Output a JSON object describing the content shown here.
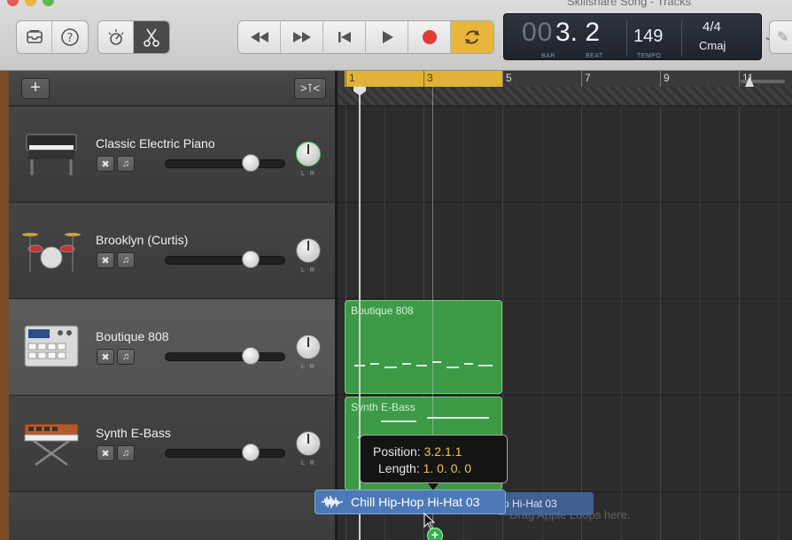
{
  "window": {
    "title": "Skillshare Song - Tracks"
  },
  "toolbar": {
    "left_icons": [
      "library-icon",
      "help-icon"
    ],
    "edit_icons": [
      "smart-controls-icon",
      "scissors-icon"
    ],
    "transport_icons": [
      "rewind-icon",
      "fast-forward-icon",
      "go-to-beginning-icon",
      "play-icon",
      "record-icon",
      "cycle-icon"
    ],
    "colors": {
      "record": "#e23c36",
      "cycle_active": "#e9b63b"
    }
  },
  "lcd": {
    "bar_digits": "00",
    "position": "3. 2",
    "bar_label": "BAR",
    "beat_label": "BEAT",
    "tempo": "149",
    "tempo_label": "TEMPO",
    "time_signature": "4/4",
    "key": "Cmaj"
  },
  "ruler": {
    "bars": [
      "1",
      "3",
      "5",
      "7",
      "9",
      "11"
    ]
  },
  "tracks": [
    {
      "name": "Classic Electric Piano",
      "icon": "electric-piano-icon"
    },
    {
      "name": "Brooklyn (Curtis)",
      "icon": "drum-kit-icon"
    },
    {
      "name": "Boutique 808",
      "icon": "drum-machine-icon"
    },
    {
      "name": "Synth E-Bass",
      "icon": "synthesizer-icon"
    }
  ],
  "regions": [
    {
      "name": "Boutique 808",
      "color": "#3d9a47"
    },
    {
      "name": "Synth E-Bass",
      "color": "#3d9a47"
    }
  ],
  "tooltip": {
    "position_label": "Position:",
    "position_value": "3.2.1.1",
    "length_label": "Length:",
    "length_value": "1. 0. 0. 0"
  },
  "drag": {
    "loop_name": "Chill Hip-Hop Hi-Hat 03",
    "ghost_label": "p Hi-Hat 03",
    "drop_hint": "Drag Apple Loops here."
  }
}
